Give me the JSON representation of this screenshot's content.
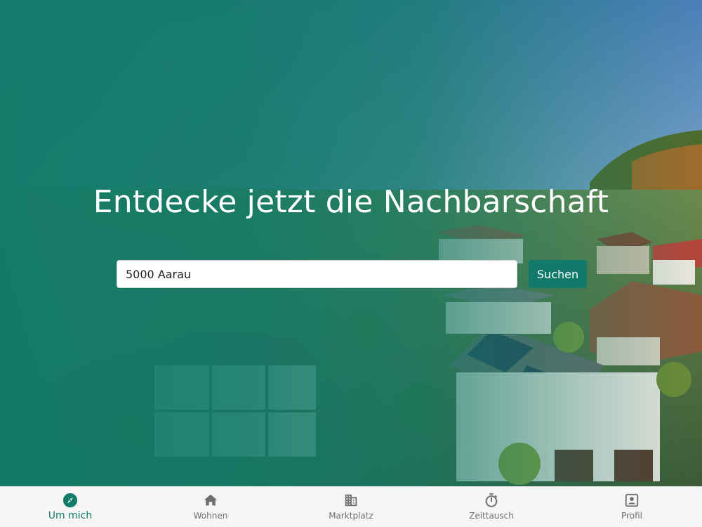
{
  "hero": {
    "headline": "Entdecke jetzt die Nachbarschaft"
  },
  "search": {
    "value": "5000 Aarau",
    "button_label": "Suchen"
  },
  "tabbar": {
    "active_color": "#127a6a",
    "inactive_color": "#6f6f6f",
    "items": [
      {
        "label": "Um mich",
        "icon": "compass-icon",
        "active": true
      },
      {
        "label": "Wohnen",
        "icon": "home-icon",
        "active": false
      },
      {
        "label": "Marktplatz",
        "icon": "building-icon",
        "active": false
      },
      {
        "label": "Zeittausch",
        "icon": "stopwatch-icon",
        "active": false
      },
      {
        "label": "Profil",
        "icon": "profile-card-icon",
        "active": false
      }
    ]
  },
  "colors": {
    "brand": "#127a6a",
    "overlay": "#127a68"
  }
}
